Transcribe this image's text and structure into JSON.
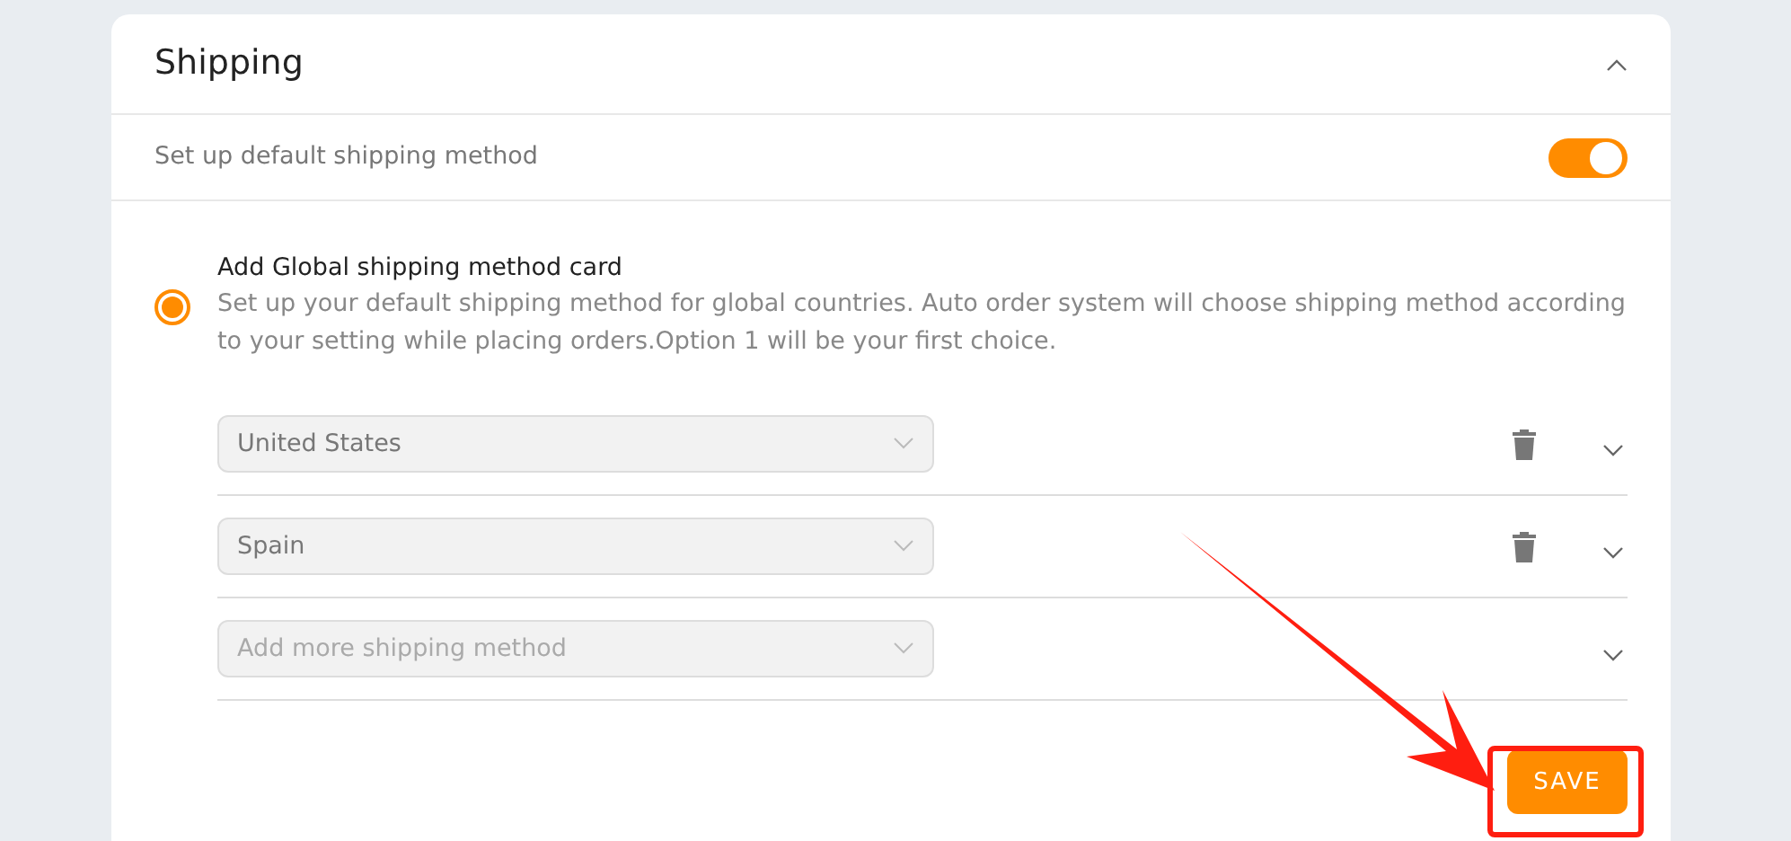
{
  "section": {
    "title": "Shipping",
    "expanded": true
  },
  "default_method": {
    "label": "Set up default shipping method",
    "on": true
  },
  "global_card": {
    "selected": true,
    "title": "Add Global shipping method card",
    "description": "Set up your default shipping method for global countries. Auto order system will choose shipping method according to your setting while placing orders.Option 1 will be your first choice."
  },
  "methods": [
    {
      "kind": "select",
      "value": "United States",
      "expanded": false
    },
    {
      "kind": "select",
      "value": "Spain",
      "expanded": false
    },
    {
      "kind": "add",
      "placeholder": "Add more shipping method",
      "expanded": false
    }
  ],
  "save_button": "SAVE",
  "annotation": {
    "arrow": true,
    "highlight_box": true
  }
}
